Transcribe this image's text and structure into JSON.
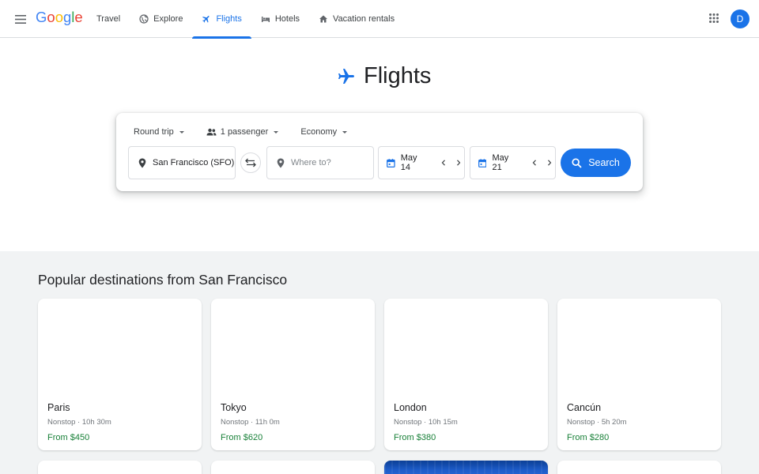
{
  "header": {
    "logo": [
      "G",
      "o",
      "o",
      "g",
      "l",
      "e"
    ],
    "logo_colors": [
      "#4285f4",
      "#ea4335",
      "#fbbc05",
      "#4285f4",
      "#34a853",
      "#ea4335"
    ],
    "nav": [
      {
        "label": "Travel",
        "icon": "none"
      },
      {
        "label": "Explore",
        "icon": "globe-icon"
      },
      {
        "label": "Flights",
        "icon": "plane-icon",
        "active": true
      },
      {
        "label": "Hotels",
        "icon": "bed-icon"
      },
      {
        "label": "Vacation rentals",
        "icon": "home-icon"
      }
    ],
    "avatar_initial": "D"
  },
  "hero": {
    "title": "Flights"
  },
  "search": {
    "trip_type": "Round trip",
    "passengers": "1 passenger",
    "cabin": "Economy",
    "from": "San Francisco (SFO)",
    "to_placeholder": "Where to?",
    "depart": "May 14",
    "return": "May 21",
    "button": "Search"
  },
  "popular": {
    "title": "Popular destinations from San Francisco",
    "cards": [
      {
        "city": "Paris",
        "meta": "Nonstop · 10h 30m",
        "price": "From $450"
      },
      {
        "city": "Tokyo",
        "meta": "Nonstop · 11h 0m",
        "price": "From $620"
      },
      {
        "city": "London",
        "meta": "Nonstop · 10h 15m",
        "price": "From $380"
      },
      {
        "city": "Cancún",
        "meta": "Nonstop · 5h 20m",
        "price": "From $280"
      }
    ]
  },
  "colors": {
    "accent": "#1a73e8",
    "price": "#188038"
  }
}
